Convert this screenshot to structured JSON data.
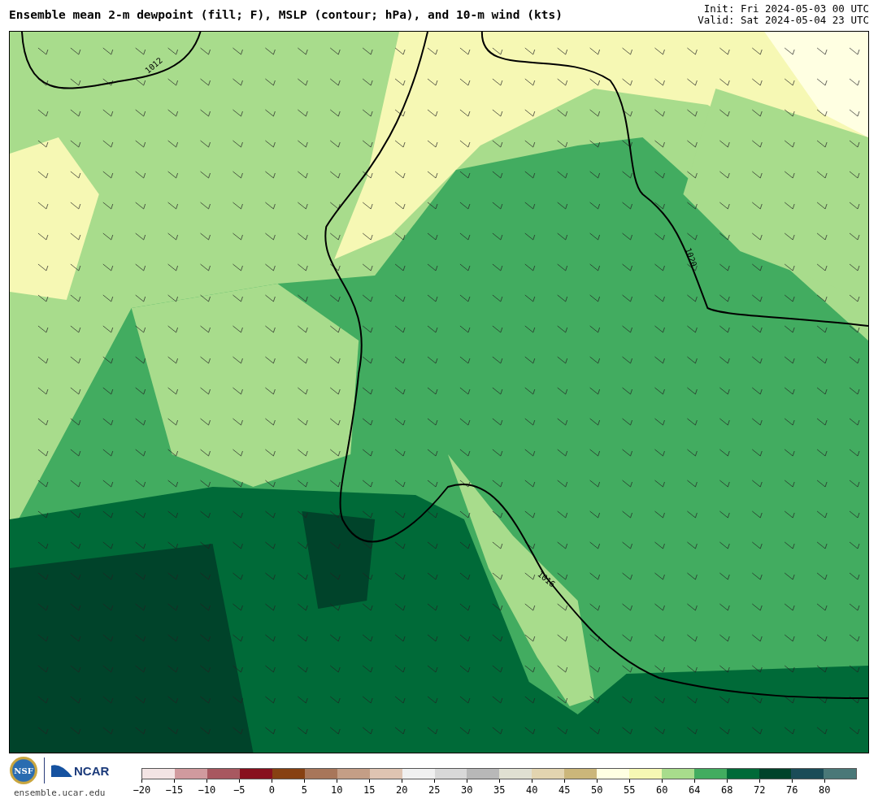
{
  "title": "Ensemble mean 2-m dewpoint (fill; F), MSLP (contour; hPa), and 10-m wind (kts)",
  "init": "Init: Fri 2024-05-03 00 UTC",
  "valid": "Valid: Sat 2024-05-04 23 UTC",
  "map": {
    "contours": [
      {
        "label": "1012"
      },
      {
        "label": "1020"
      },
      {
        "label": "1016"
      }
    ]
  },
  "footer": {
    "logo_left": "NSF",
    "logo_right": "NCAR",
    "site": "ensemble.ucar.edu"
  },
  "colorbar": [
    {
      "label": "−20",
      "color": "#f3e4e4"
    },
    {
      "label": "−15",
      "color": "#d09a9e"
    },
    {
      "label": "−10",
      "color": "#a85860"
    },
    {
      "label": "−5",
      "color": "#88101e"
    },
    {
      "label": "0",
      "color": "#874112"
    },
    {
      "label": "5",
      "color": "#a8765a"
    },
    {
      "label": "10",
      "color": "#c49e86"
    },
    {
      "label": "15",
      "color": "#dec4b2"
    },
    {
      "label": "20",
      "color": "#f0f0f0"
    },
    {
      "label": "25",
      "color": "#d8d8d8"
    },
    {
      "label": "30",
      "color": "#b8b8b8"
    },
    {
      "label": "35",
      "color": "#e0e0d2"
    },
    {
      "label": "40",
      "color": "#e2d4b0"
    },
    {
      "label": "45",
      "color": "#cbb67a"
    },
    {
      "label": "50",
      "color": "#ffffe2"
    },
    {
      "label": "55",
      "color": "#f6f8b4"
    },
    {
      "label": "60",
      "color": "#a8dc8c"
    },
    {
      "label": "64",
      "color": "#42ac60"
    },
    {
      "label": "68",
      "color": "#006a38"
    },
    {
      "label": "72",
      "color": "#00432a"
    },
    {
      "label": "76",
      "color": "#1a4c58"
    },
    {
      "label": "80",
      "color": "#4a7878"
    }
  ]
}
